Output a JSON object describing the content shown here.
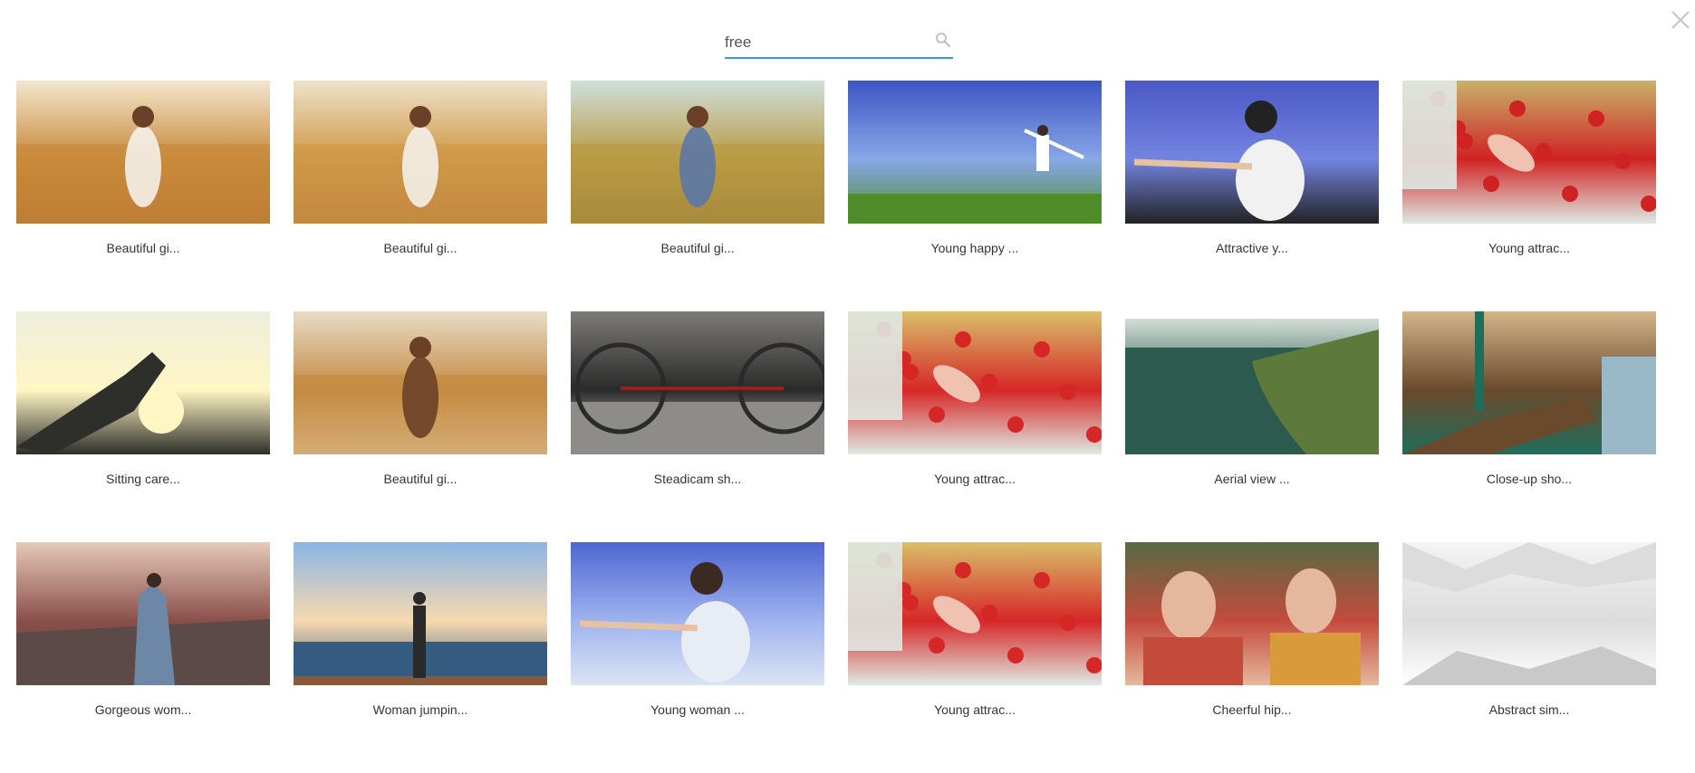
{
  "search": {
    "value": "free",
    "icon": "search-icon"
  },
  "close": {
    "icon": "close-icon"
  },
  "videos": [
    {
      "caption": "Beautiful gi...",
      "scene": "wheat-girl-white",
      "palette": [
        "#f3e7cf",
        "#c98a3c",
        "#a35e22",
        "#f4f1ea"
      ]
    },
    {
      "caption": "Beautiful gi...",
      "scene": "wheat-girl-far",
      "palette": [
        "#eee3cb",
        "#cf9848",
        "#a8652b",
        "#f3f0e8"
      ]
    },
    {
      "caption": "Beautiful gi...",
      "scene": "wheat-girl-dress",
      "palette": [
        "#cfe0dc",
        "#b99a45",
        "#7b6a2a",
        "#5b78a6"
      ]
    },
    {
      "caption": "Young happy ...",
      "scene": "sky-grass-arms",
      "palette": [
        "#3d55c4",
        "#87a7e6",
        "#4f8d2a",
        "#ffffff"
      ]
    },
    {
      "caption": "Attractive y...",
      "scene": "blue-hair-arms",
      "palette": [
        "#4b58c6",
        "#7384df",
        "#222222",
        "#f1f1f1"
      ]
    },
    {
      "caption": "Young attrac...",
      "scene": "poppies-hand",
      "palette": [
        "#c8b26a",
        "#cf2323",
        "#dfe9e4",
        "#7a8a40"
      ]
    },
    {
      "caption": "Sitting care...",
      "scene": "sun-hand",
      "palette": [
        "#eeeede",
        "#fff6c4",
        "#2e2e2a",
        "#d9dcc8"
      ]
    },
    {
      "caption": "Beautiful gi...",
      "scene": "wheat-portrait",
      "palette": [
        "#e8dcc6",
        "#c48b43",
        "#fbf7ef",
        "#6a4026"
      ]
    },
    {
      "caption": "Steadicam sh...",
      "scene": "bikes",
      "palette": [
        "#7e7c78",
        "#2a2a2a",
        "#e6e6e6",
        "#a11d1d"
      ]
    },
    {
      "caption": "Young attrac...",
      "scene": "poppies-hand-2",
      "palette": [
        "#d9c06a",
        "#d62727",
        "#dfe9e4",
        "#8a9848"
      ]
    },
    {
      "caption": "Aerial view ...",
      "scene": "coast",
      "palette": [
        "#e5ece6",
        "#2d5a4e",
        "#5d7a3a",
        "#b4c5c1"
      ]
    },
    {
      "caption": "Close-up sho...",
      "scene": "syringe",
      "palette": [
        "#d4b48a",
        "#6a4a2c",
        "#1f6d5b",
        "#e8e1cf"
      ]
    },
    {
      "caption": "Gorgeous wom...",
      "scene": "rocks-woman",
      "palette": [
        "#e6c9b9",
        "#8a4f4a",
        "#5b4a48",
        "#6d88a7"
      ]
    },
    {
      "caption": "Woman jumpin...",
      "scene": "sea-silhouette",
      "palette": [
        "#8bb5e3",
        "#f7d9b0",
        "#355c80",
        "#2a2a2a"
      ]
    },
    {
      "caption": "Young woman ...",
      "scene": "sky-woman",
      "palette": [
        "#4e66d1",
        "#9fb3ef",
        "#dbe4f3",
        "#3a2a22"
      ]
    },
    {
      "caption": "Young attrac...",
      "scene": "poppies-hand-3",
      "palette": [
        "#d9c06a",
        "#d62727",
        "#dfe9e4",
        "#8a9848"
      ]
    },
    {
      "caption": "Cheerful hip...",
      "scene": "couple",
      "palette": [
        "#566b44",
        "#c44b3c",
        "#e5b89d",
        "#3a5a7a"
      ]
    },
    {
      "caption": "Abstract sim...",
      "scene": "abstract-white",
      "palette": [
        "#f4f4f4",
        "#dcdcdc",
        "#ffffff",
        "#c9c9c9"
      ]
    }
  ]
}
